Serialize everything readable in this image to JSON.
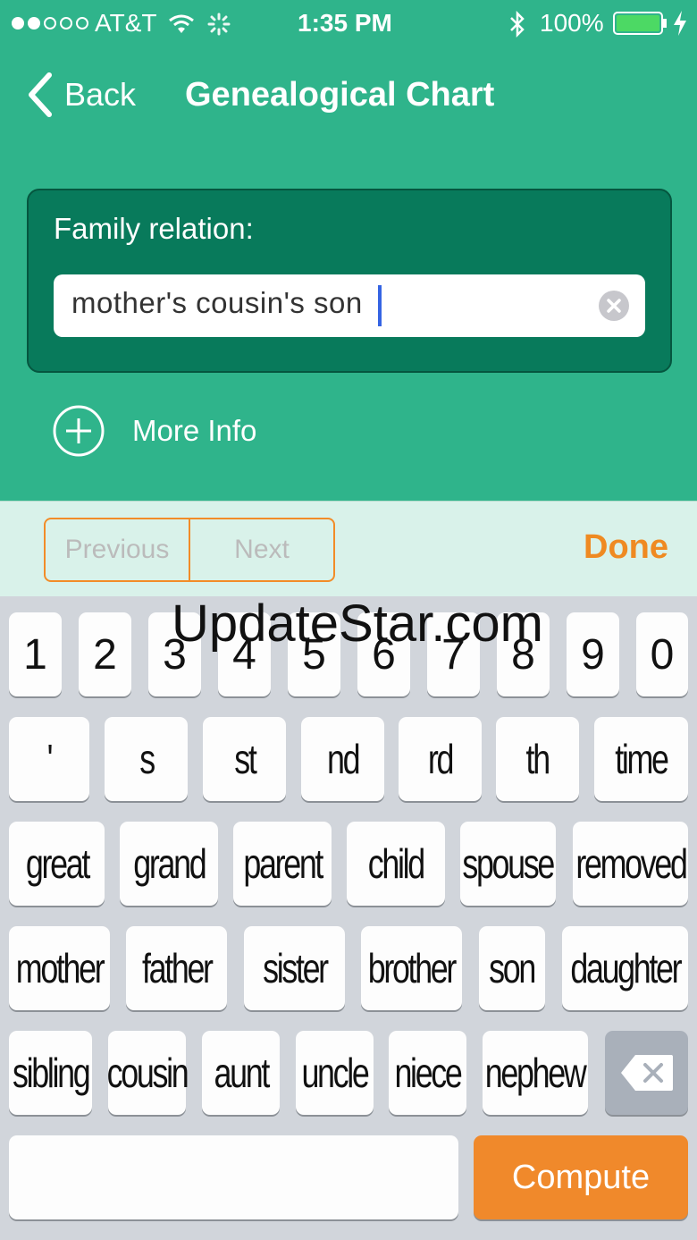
{
  "status_bar": {
    "carrier": "AT&T",
    "time": "1:35 PM",
    "battery": "100%"
  },
  "nav": {
    "back_label": "Back",
    "title": "Genealogical Chart"
  },
  "form": {
    "label": "Family relation:",
    "value": "mother's cousin's son"
  },
  "more_info": {
    "label": "More Info"
  },
  "accessory": {
    "previous_label": "Previous",
    "next_label": "Next",
    "done_label": "Done"
  },
  "keyboard": {
    "row1": [
      "1",
      "2",
      "3",
      "4",
      "5",
      "6",
      "7",
      "8",
      "9",
      "0"
    ],
    "row2": [
      "'",
      "s",
      "st",
      "nd",
      "rd",
      "th",
      "time"
    ],
    "row3": [
      "great",
      "grand",
      "parent",
      "child",
      "spouse",
      "removed"
    ],
    "row4": [
      "mother",
      "father",
      "sister",
      "brother",
      "son",
      "daughter"
    ],
    "row5": [
      "sibling",
      "cousin",
      "aunt",
      "uncle",
      "niece",
      "nephew"
    ],
    "compute_label": "Compute"
  },
  "watermark": "UpdateStar.com",
  "colors": {
    "accent_green": "#2fb48b",
    "dark_green": "#087a5b",
    "orange": "#f0892b"
  },
  "icons": [
    "signal-dots-icon",
    "wifi-icon",
    "activity-spinner-icon",
    "bluetooth-icon",
    "battery-icon",
    "charging-bolt-icon",
    "back-chevron-icon",
    "clear-icon",
    "plus-circle-icon",
    "backspace-icon"
  ]
}
